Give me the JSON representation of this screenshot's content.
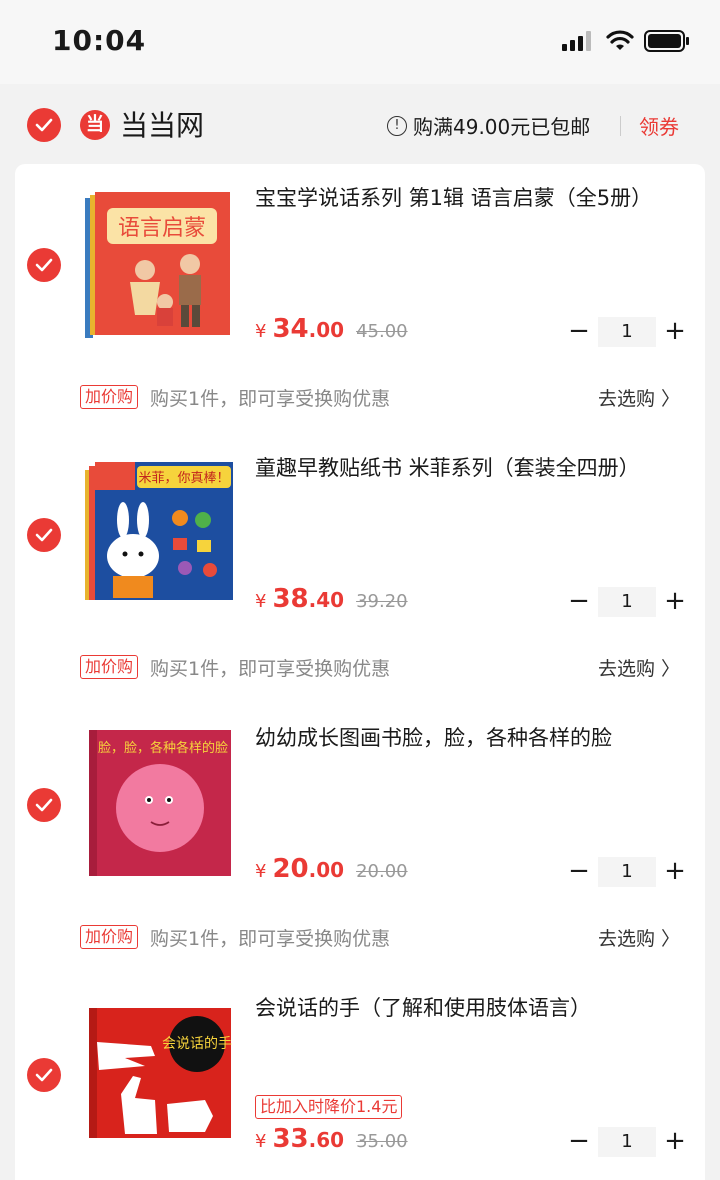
{
  "status": {
    "time": "10:04"
  },
  "shop": {
    "name": "当当网",
    "shipping_note": "购满49.00元已包邮",
    "coupon_label": "领券",
    "logo_char": "当"
  },
  "items": [
    {
      "title": "宝宝学说话系列 第1辑  语言启蒙（全5册）",
      "price_symbol": "¥",
      "price_int": "34",
      "price_dec": ".00",
      "original_price": "45.00",
      "quantity": "1",
      "cover_text": "语言启蒙",
      "promo_tag": "加价购",
      "promo_text": "购买1件，即可享受换购优惠",
      "promo_link": "去选购 〉"
    },
    {
      "title": "童趣早教贴纸书  米菲系列（套装全四册）",
      "price_symbol": "¥",
      "price_int": "38",
      "price_dec": ".40",
      "original_price": "39.20",
      "quantity": "1",
      "cover_text": "米菲，你真棒！",
      "promo_tag": "加价购",
      "promo_text": "购买1件，即可享受换购优惠",
      "promo_link": "去选购 〉"
    },
    {
      "title": "幼幼成长图画书脸，脸，各种各样的脸",
      "price_symbol": "¥",
      "price_int": "20",
      "price_dec": ".00",
      "original_price": "20.00",
      "quantity": "1",
      "cover_text": "脸，脸，各种各样的脸",
      "promo_tag": "加价购",
      "promo_text": "购买1件，即可享受换购优惠",
      "promo_link": "去选购 〉"
    },
    {
      "title": "会说话的手（了解和使用肢体语言）",
      "price_symbol": "¥",
      "price_int": "33",
      "price_dec": ".60",
      "original_price": "35.00",
      "quantity": "1",
      "cover_text": "会说话的手",
      "drop_tag": "比加入时降价1.4元"
    }
  ],
  "colors": {
    "accent": "#ea3a35",
    "muted": "#999999",
    "background": "#f2f2f2"
  }
}
